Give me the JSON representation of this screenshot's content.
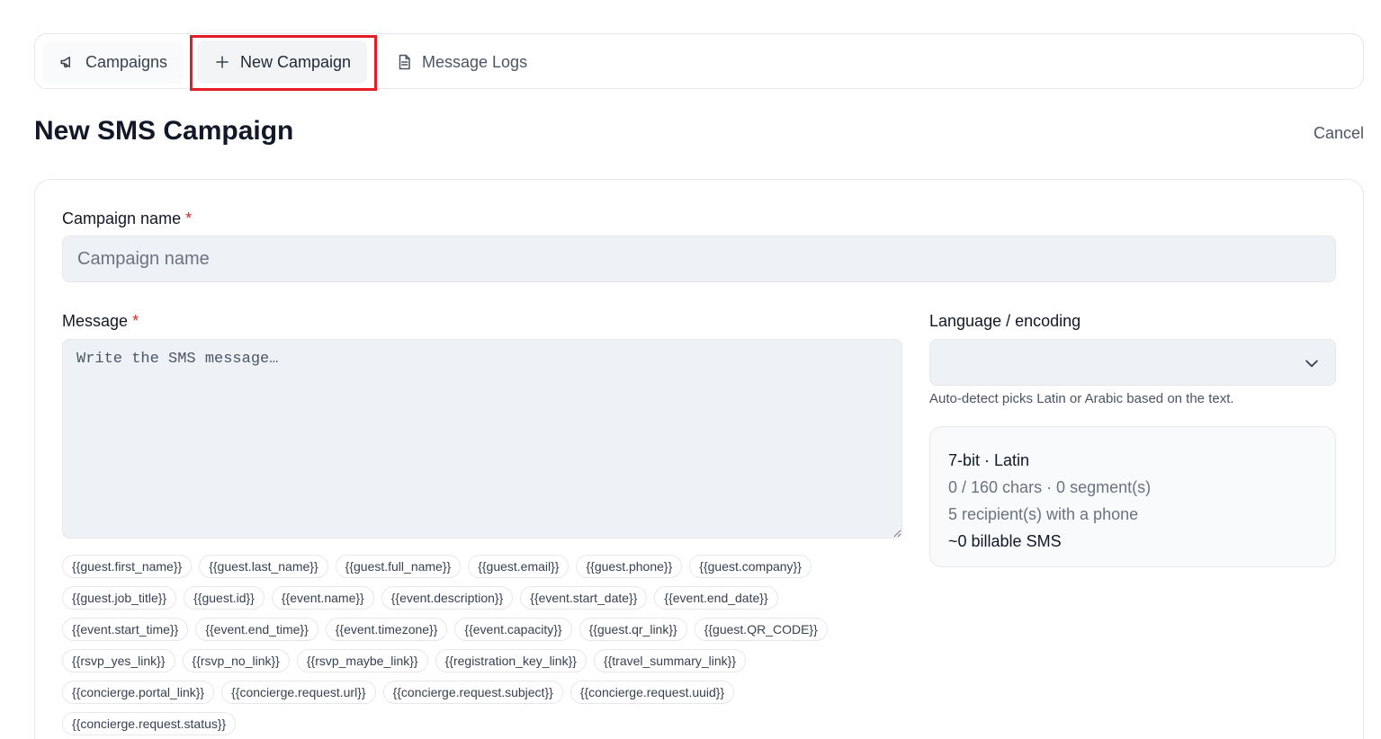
{
  "tabs": {
    "campaigns": "Campaigns",
    "new_campaign": "New Campaign",
    "message_logs": "Message Logs"
  },
  "header": {
    "title": "New SMS Campaign",
    "cancel": "Cancel"
  },
  "form": {
    "campaign_name": {
      "label": "Campaign name",
      "required": "*",
      "placeholder": "Campaign name",
      "value": ""
    },
    "message": {
      "label": "Message",
      "required": "*",
      "placeholder": "Write the SMS message…",
      "value": ""
    },
    "language": {
      "label": "Language / encoding",
      "value": "",
      "hint": "Auto-detect picks Latin or Arabic based on the text."
    },
    "tokens": [
      "{{guest.first_name}}",
      "{{guest.last_name}}",
      "{{guest.full_name}}",
      "{{guest.email}}",
      "{{guest.phone}}",
      "{{guest.company}}",
      "{{guest.job_title}}",
      "{{guest.id}}",
      "{{event.name}}",
      "{{event.description}}",
      "{{event.start_date}}",
      "{{event.end_date}}",
      "{{event.start_time}}",
      "{{event.end_time}}",
      "{{event.timezone}}",
      "{{event.capacity}}",
      "{{guest.qr_link}}",
      "{{guest.QR_CODE}}",
      "{{rsvp_yes_link}}",
      "{{rsvp_no_link}}",
      "{{rsvp_maybe_link}}",
      "{{registration_key_link}}",
      "{{travel_summary_link}}",
      "{{concierge.portal_link}}",
      "{{concierge.request.url}}",
      "{{concierge.request.subject}}",
      "{{concierge.request.uuid}}",
      "{{concierge.request.status}}"
    ]
  },
  "stats": {
    "encoding": "7-bit · Latin",
    "chars": "0 / 160 chars · 0 segment(s)",
    "recipients": "5 recipient(s) with a phone",
    "billable": "~0 billable SMS"
  },
  "colors": {
    "highlight": "#e11d26",
    "required": "#dc2626",
    "input_bg": "#eef2f7"
  }
}
